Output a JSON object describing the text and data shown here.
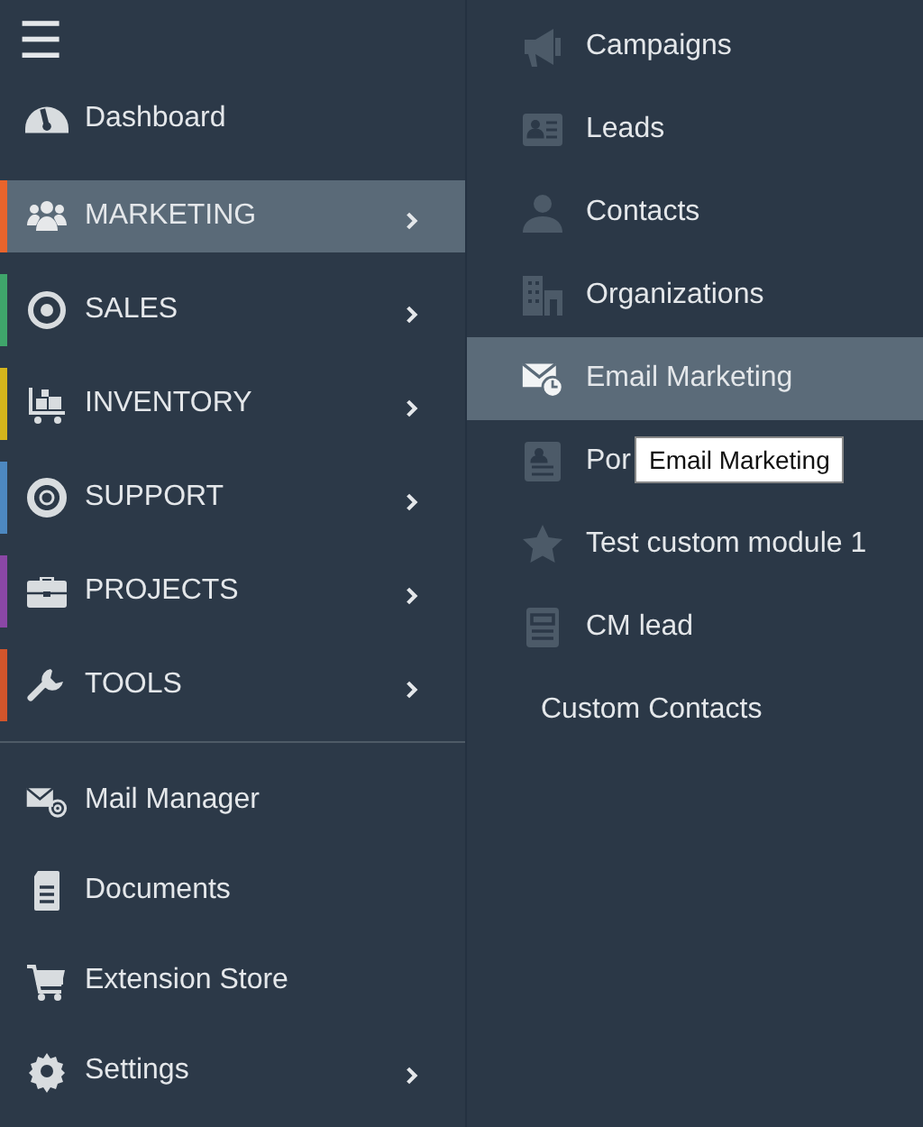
{
  "sidebar": {
    "menu_button": "☰",
    "top_items": [
      {
        "label": "Dashboard",
        "has_submenu": false
      }
    ],
    "modules": [
      {
        "label": "MARKETING",
        "color": "#e8642c",
        "selected": true
      },
      {
        "label": "SALES",
        "color": "#3fa56b",
        "selected": false
      },
      {
        "label": "INVENTORY",
        "color": "#d4b51c",
        "selected": false
      },
      {
        "label": "SUPPORT",
        "color": "#4d88c0",
        "selected": false
      },
      {
        "label": "PROJECTS",
        "color": "#8b47a6",
        "selected": false
      },
      {
        "label": "TOOLS",
        "color": "#d2552b",
        "selected": false
      }
    ],
    "bottom_items": [
      {
        "label": "Mail Manager",
        "has_submenu": false
      },
      {
        "label": "Documents",
        "has_submenu": false
      },
      {
        "label": "Extension Store",
        "has_submenu": false
      },
      {
        "label": "Settings",
        "has_submenu": true
      }
    ]
  },
  "submenu": {
    "items": [
      {
        "label": "Campaigns",
        "selected": false
      },
      {
        "label": "Leads",
        "selected": false
      },
      {
        "label": "Contacts",
        "selected": false
      },
      {
        "label": "Organizations",
        "selected": false
      },
      {
        "label": "Email Marketing",
        "selected": true
      },
      {
        "label": "Por",
        "selected": false
      },
      {
        "label": "Test custom module 1",
        "selected": false
      },
      {
        "label": "CM lead",
        "selected": false
      },
      {
        "label": "Custom Contacts",
        "selected": false
      }
    ],
    "tooltip": "Email Marketing"
  }
}
